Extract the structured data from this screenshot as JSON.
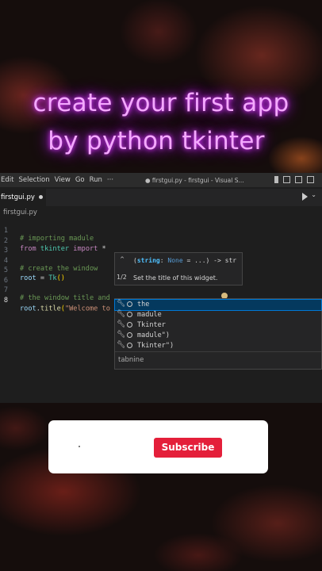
{
  "headline": {
    "line1": "create your first app",
    "line2": "by python tkinter"
  },
  "menu": {
    "items": [
      "Edit",
      "Selection",
      "View",
      "Go",
      "Run",
      "···"
    ],
    "window_title": "● firstgui.py - firstgui - Visual S..."
  },
  "tab": {
    "label": "firstgui.py"
  },
  "breadcrumb": "firstgui.py",
  "code": {
    "line_numbers": [
      "1",
      "2",
      "3",
      "4",
      "5",
      "6",
      "7",
      "8"
    ],
    "l1": "# importing madule",
    "l2_kw1": "from",
    "l2_mod": "tkinter",
    "l2_kw2": "import",
    "l2_star": " *",
    "l4": "# create the window",
    "l5_var": "root",
    "l5_eq": " = ",
    "l5_fn": "Tk",
    "l5_paren": "()",
    "l7": "# the window title and",
    "l8_var": "root",
    "l8_dot": ".",
    "l8_fn": "title",
    "l8_open": "(",
    "l8_str": "\"Welcome to \"",
    "l8_close": ")"
  },
  "signature": {
    "up": "^",
    "down": "v",
    "page": "1/2",
    "open": "(",
    "param": "string",
    "colon": ": ",
    "default": "None",
    "rest": " = ...) -> str",
    "doc": "Set the title of this widget."
  },
  "suggestions": {
    "items": [
      "the",
      "madule",
      "Tkinter",
      "madule\")",
      "Tkinter\")"
    ],
    "selected_index": 0,
    "footer": "tabnine"
  },
  "subscribe": {
    "label": "Subscribe"
  },
  "colors": {
    "headline_glow": "#e040ff",
    "editor_bg": "#1e1e1e",
    "subscribe_red": "#e41f3a",
    "selection_blue": "#04395e"
  }
}
